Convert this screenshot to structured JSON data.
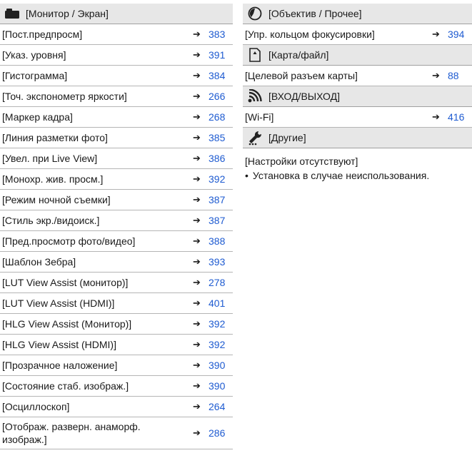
{
  "left": {
    "header": {
      "icon": "monitor-icon",
      "title": "[Монитор / Экран]"
    },
    "rows": [
      {
        "label": "[Пост.предпросм]",
        "page": "383"
      },
      {
        "label": "[Указ. уровня]",
        "page": "391"
      },
      {
        "label": "[Гистограмма]",
        "page": "384"
      },
      {
        "label": "[Точ. экспонометр яркости]",
        "page": "266"
      },
      {
        "label": "[Маркер кадра]",
        "page": "268"
      },
      {
        "label": "[Линия разметки фото]",
        "page": "385"
      },
      {
        "label": "[Увел. при Live View]",
        "page": "386"
      },
      {
        "label": "[Монохр. жив. просм.]",
        "page": "392"
      },
      {
        "label": "[Режим ночной съемки]",
        "page": "387"
      },
      {
        "label": "[Стиль экр./видоиск.]",
        "page": "387"
      },
      {
        "label": "[Пред.просмотр фото/видео]",
        "page": "388"
      },
      {
        "label": "[Шаблон Зебра]",
        "page": "393"
      },
      {
        "label": "[LUT View Assist (монитор)]",
        "page": "278"
      },
      {
        "label": "[LUT View Assist (HDMI)]",
        "page": "401"
      },
      {
        "label": "[HLG View Assist (Монитор)]",
        "page": "392"
      },
      {
        "label": "[HLG View Assist (HDMI)]",
        "page": "392"
      },
      {
        "label": "[Прозрачное наложение]",
        "page": "390"
      },
      {
        "label": "[Состояние стаб. изображ.]",
        "page": "390"
      },
      {
        "label": "[Осциллоскоп]",
        "page": "264"
      }
    ],
    "last_row": {
      "label_line1": "[Отображ. разверн. анаморф.",
      "label_line2": "изображ.]",
      "page": "286"
    }
  },
  "right": {
    "lens_header": {
      "icon": "lens-icon",
      "title": "[Объектив / Прочее]"
    },
    "lens_row": {
      "label": "[Упр. кольцом фокусировки]",
      "page": "394"
    },
    "card_header": {
      "icon": "card-icon",
      "title": "[Карта/файл]"
    },
    "card_row": {
      "label": "[Целевой разъем карты]",
      "page": "88"
    },
    "io_header": {
      "icon": "wifi-icon",
      "title": "[ВХОД/ВЫХОД]"
    },
    "io_row": {
      "label": "[Wi-Fi]",
      "page": "416"
    },
    "other_header": {
      "icon": "wrench-icon",
      "title": "[Другие]"
    },
    "other_note": "[Настройки отсутствуют]",
    "other_bullet": "Установка в случае неиспользования."
  },
  "arrow_glyph": "➔",
  "bullet_glyph": "•"
}
